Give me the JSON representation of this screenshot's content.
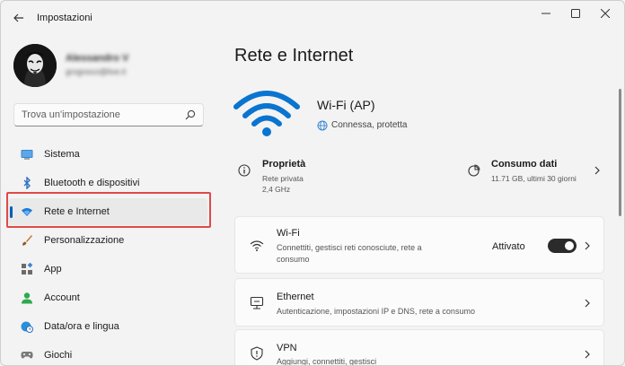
{
  "window": {
    "title": "Impostazioni",
    "controls": [
      "minimize-icon",
      "maximize-icon",
      "close-icon"
    ]
  },
  "profile": {
    "name": "Alessandro V",
    "email": "grognoco@live.it"
  },
  "search": {
    "placeholder": "Trova un'impostazione"
  },
  "sidebar": {
    "items": [
      {
        "label": "Sistema",
        "icon": "system-icon"
      },
      {
        "label": "Bluetooth e dispositivi",
        "icon": "bluetooth-icon"
      },
      {
        "label": "Rete e Internet",
        "icon": "wifi-icon",
        "active": true
      },
      {
        "label": "Personalizzazione",
        "icon": "brush-icon"
      },
      {
        "label": "App",
        "icon": "apps-icon"
      },
      {
        "label": "Account",
        "icon": "account-icon"
      },
      {
        "label": "Data/ora e lingua",
        "icon": "clock-globe-icon"
      },
      {
        "label": "Giochi",
        "icon": "gamepad-icon"
      }
    ]
  },
  "main": {
    "title": "Rete e Internet",
    "network": {
      "name": "Wi-Fi (AP)",
      "status": "Connessa, protetta"
    },
    "properties": {
      "title": "Proprietà",
      "line1": "Rete privata",
      "line2": "2,4 GHz"
    },
    "data_usage": {
      "title": "Consumo dati",
      "value": "11.71 GB, ultimi 30 giorni"
    },
    "cards": [
      {
        "title": "Wi-Fi",
        "desc_line1": "Connettiti, gestisci reti conosciute, rete a",
        "desc_line2": "consumo",
        "toggle_label": "Attivato",
        "toggle_on": true
      },
      {
        "title": "Ethernet",
        "desc_line1": "Autenticazione, impostazioni IP e DNS, rete a consumo"
      },
      {
        "title": "VPN",
        "desc_line1": "Aggiungi, connettiti, gestisci"
      }
    ]
  },
  "colors": {
    "accent": "#005fb8",
    "highlight": "#e04848",
    "background": "#f3f3f3"
  }
}
